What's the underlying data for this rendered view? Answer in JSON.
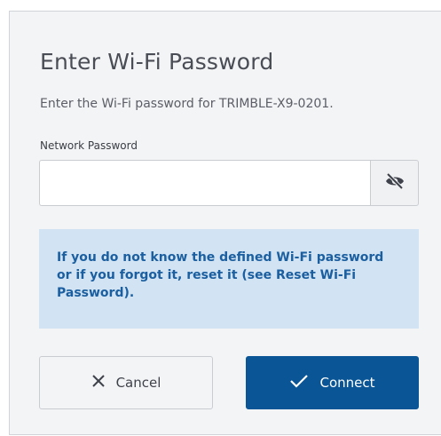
{
  "dialog": {
    "title": "Enter Wi-Fi Password",
    "subtitle": "Enter the Wi-Fi password for TRIMBLE-X9-0201.",
    "field_label": "Network Password",
    "password_value": "",
    "toggle_icon": "eye-slash-icon",
    "info_text": "If you do not know the defined Wi-Fi password or if you forgot it, reset it (see Reset Wi-Fi Password).",
    "cancel_label": "Cancel",
    "connect_label": "Connect"
  },
  "colors": {
    "dialog_bg": "#f3f4f6",
    "info_bg": "#d2e4f3",
    "info_text": "#1b5fa0",
    "primary": "#0a5596"
  }
}
